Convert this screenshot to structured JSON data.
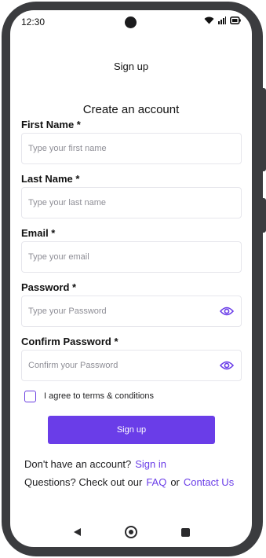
{
  "status_bar": {
    "time": "12:30",
    "icons": [
      "wifi-icon",
      "signal-icon",
      "battery-icon"
    ]
  },
  "header": {
    "title": "Sign up"
  },
  "form": {
    "title": "Create an account",
    "first_name": {
      "label": "First Name *",
      "placeholder": "Type your first name",
      "value": ""
    },
    "last_name": {
      "label": "Last Name *",
      "placeholder": "Type your last name",
      "value": ""
    },
    "email": {
      "label": "Email *",
      "placeholder": "Type your email",
      "value": ""
    },
    "password": {
      "label": "Password *",
      "placeholder": "Type your Password",
      "value": "",
      "icon": "eye-icon"
    },
    "confirm_password": {
      "label": "Confirm Password *",
      "placeholder": "Confirm your Password",
      "value": "",
      "icon": "eye-icon"
    },
    "terms_label": "I agree to terms & conditions",
    "terms_checked": false,
    "submit_label": "Sign up"
  },
  "footer": {
    "signin_prompt": "Don't have an account?",
    "signin_link": "Sign in",
    "questions_prompt": "Questions? Check out our",
    "faq_link": "FAQ",
    "or_text": "or",
    "contact_link": "Contact Us"
  },
  "nav": {
    "icons": [
      "back-icon",
      "home-icon",
      "recents-icon"
    ]
  },
  "colors": {
    "accent": "#6a3de8",
    "frame": "#3b3c3f",
    "field_border": "#e6e6ec"
  }
}
